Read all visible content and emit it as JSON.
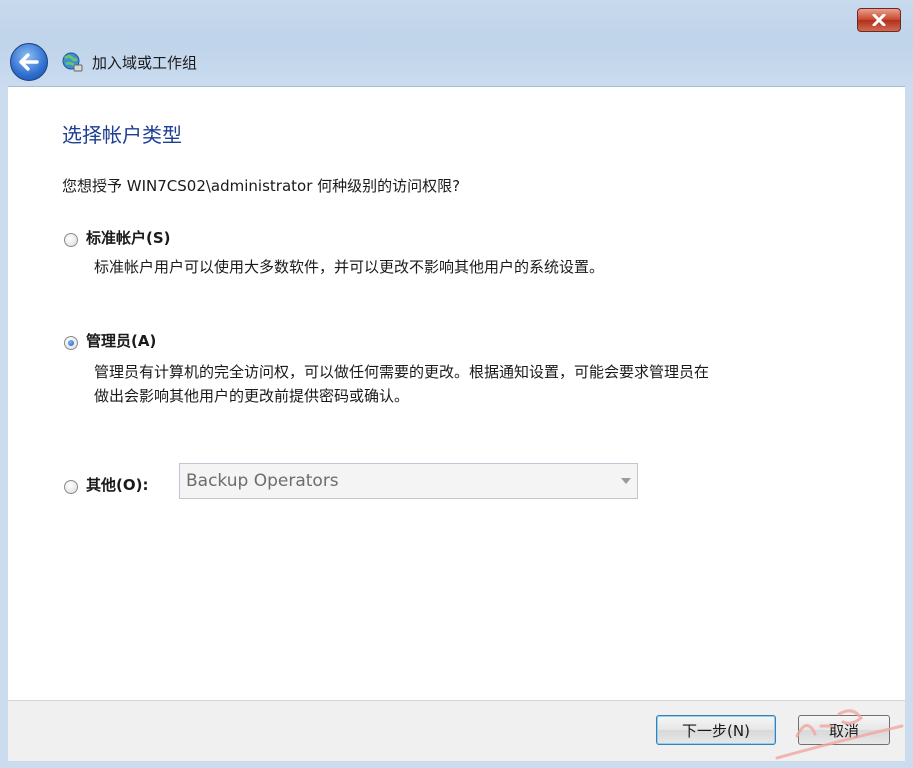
{
  "window": {
    "title": "加入域或工作组"
  },
  "page": {
    "heading": "选择帐户类型",
    "question": "您想授予 WIN7CS02\\administrator 何种级别的访问权限?"
  },
  "options": [
    {
      "label": "标准帐户(S)",
      "checked": false,
      "description_lines": [
        "标准帐户用户可以使用大多数软件，并可以更改不影响其他用户的系统设置。"
      ]
    },
    {
      "label": "管理员(A)",
      "checked": true,
      "description_lines": [
        "管理员有计算机的完全访问权，可以做任何需要的更改。根据通知设置，可能会要求管理员在",
        "做出会影响其他用户的更改前提供密码或确认。"
      ]
    },
    {
      "label": "其他(O):",
      "checked": false,
      "select_value": "Backup Operators"
    }
  ],
  "buttons": {
    "next": "下一步(N)",
    "cancel": "取消"
  },
  "icons": {
    "close": "close-icon",
    "back": "back-arrow-icon",
    "wizard": "network-globe-icon",
    "dropdown": "chevron-down-icon"
  },
  "colors": {
    "heading": "#1e3f94",
    "frame": "#c9daee",
    "close": "#c9442c"
  }
}
